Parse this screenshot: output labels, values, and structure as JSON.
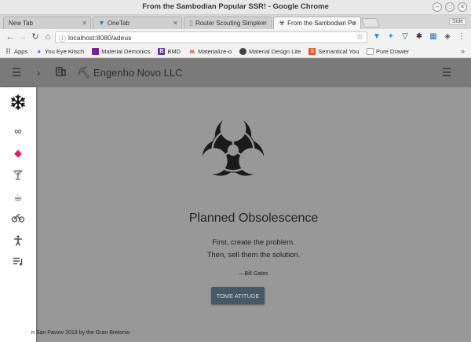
{
  "window": {
    "title": "From the Sambodian Popular SSR! - Google Chrome"
  },
  "tabs": [
    {
      "label": "New Tab",
      "icon": "none",
      "active": false
    },
    {
      "label": "OneTab",
      "icon": "onetab-icon",
      "active": false
    },
    {
      "label": "Router Scouting Simplex",
      "icon": "document-icon",
      "active": false
    },
    {
      "label": "From the Sambodian Po",
      "icon": "biohazard-icon",
      "active": true
    }
  ],
  "guest_label": "Side",
  "omnibox": {
    "url": "localhost:8080/adeus"
  },
  "bookmarks": [
    {
      "label": "Apps",
      "icon": "apps-grid-icon",
      "color": "#555555"
    },
    {
      "label": "You Eye Kitsch",
      "icon": "globe-icon",
      "color": "#1e88e5"
    },
    {
      "label": "Material Demonics",
      "icon": "square-icon",
      "color": "#7b1fa2"
    },
    {
      "label": "BMD",
      "icon": "b-icon",
      "color": "#5e35b1"
    },
    {
      "label": "Materialize-o",
      "icon": "m-icon",
      "color": "#e53935"
    },
    {
      "label": "Material Design Lite",
      "icon": "mdl-icon",
      "color": "#424242"
    },
    {
      "label": "Semantical You",
      "icon": "s-icon",
      "color": "#f4511e"
    },
    {
      "label": "Pure Drawer",
      "icon": "page-icon",
      "color": "#9e9e9e"
    }
  ],
  "app": {
    "brand": "Engenho Novo LLC",
    "hero": {
      "title": "Planned Obsolescence",
      "line1": "First, create the problem.",
      "line2": "Then, sell them the solution.",
      "author": "—Bill Gates",
      "cta": "TOME ATITUDE"
    },
    "footer": "n San Paviov 2018 by the Gran Bretonio",
    "overlay_color": "#989898",
    "cta_color": "#455a64"
  }
}
